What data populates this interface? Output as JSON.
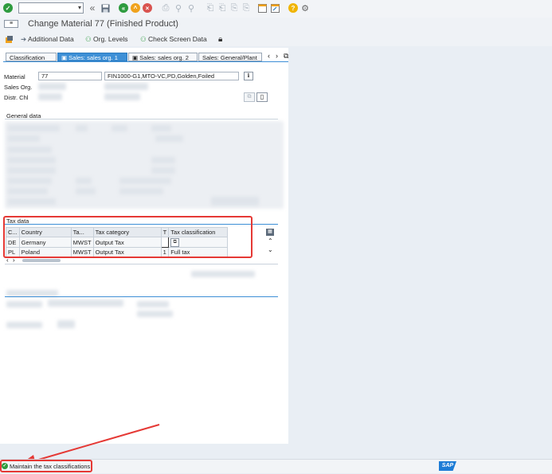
{
  "title": "Change Material 77 (Finished Product)",
  "toolbar": {
    "command_value": "",
    "icons": [
      "enter-icon",
      "back-icon",
      "save-icon",
      "exit-icon",
      "cancel-icon",
      "print-icon",
      "find-icon",
      "help-icon",
      "settings-icon"
    ]
  },
  "app_toolbar": {
    "additional_data": "Additional Data",
    "org_levels": "Org. Levels",
    "check_screen_data": "Check Screen Data"
  },
  "tabs": [
    {
      "label": "Classification",
      "active": false
    },
    {
      "label": "Sales: sales org. 1",
      "active": true
    },
    {
      "label": "Sales: sales org. 2",
      "active": false
    },
    {
      "label": "Sales: General/Plant",
      "active": false
    }
  ],
  "header": {
    "material_label": "Material",
    "material_value": "77",
    "material_desc": "FIN1000-G1,MTO-VC,PD,Golden,Foiled",
    "sales_org_label": "Sales Org.",
    "distr_chl_label": "Distr. Chl"
  },
  "general_data": {
    "title": "General data"
  },
  "tax_data": {
    "title": "Tax data",
    "columns": [
      "C...",
      "Country",
      "Ta...",
      "Tax category",
      "T",
      "Tax classification"
    ],
    "rows": [
      {
        "c": "DE",
        "country": "Germany",
        "ta": "MWST",
        "category": "Output Tax",
        "t": "",
        "classification": ""
      },
      {
        "c": "PL",
        "country": "Poland",
        "ta": "MWST",
        "category": "Output Tax",
        "t": "1",
        "classification": "Full tax"
      }
    ]
  },
  "status": {
    "message": "Maintain the tax classifications",
    "type": "success"
  },
  "brand": {
    "logo": "SAP"
  },
  "colors": {
    "accent": "#3d8fd6",
    "highlight": "#e53935",
    "success": "#2e9b3e"
  }
}
